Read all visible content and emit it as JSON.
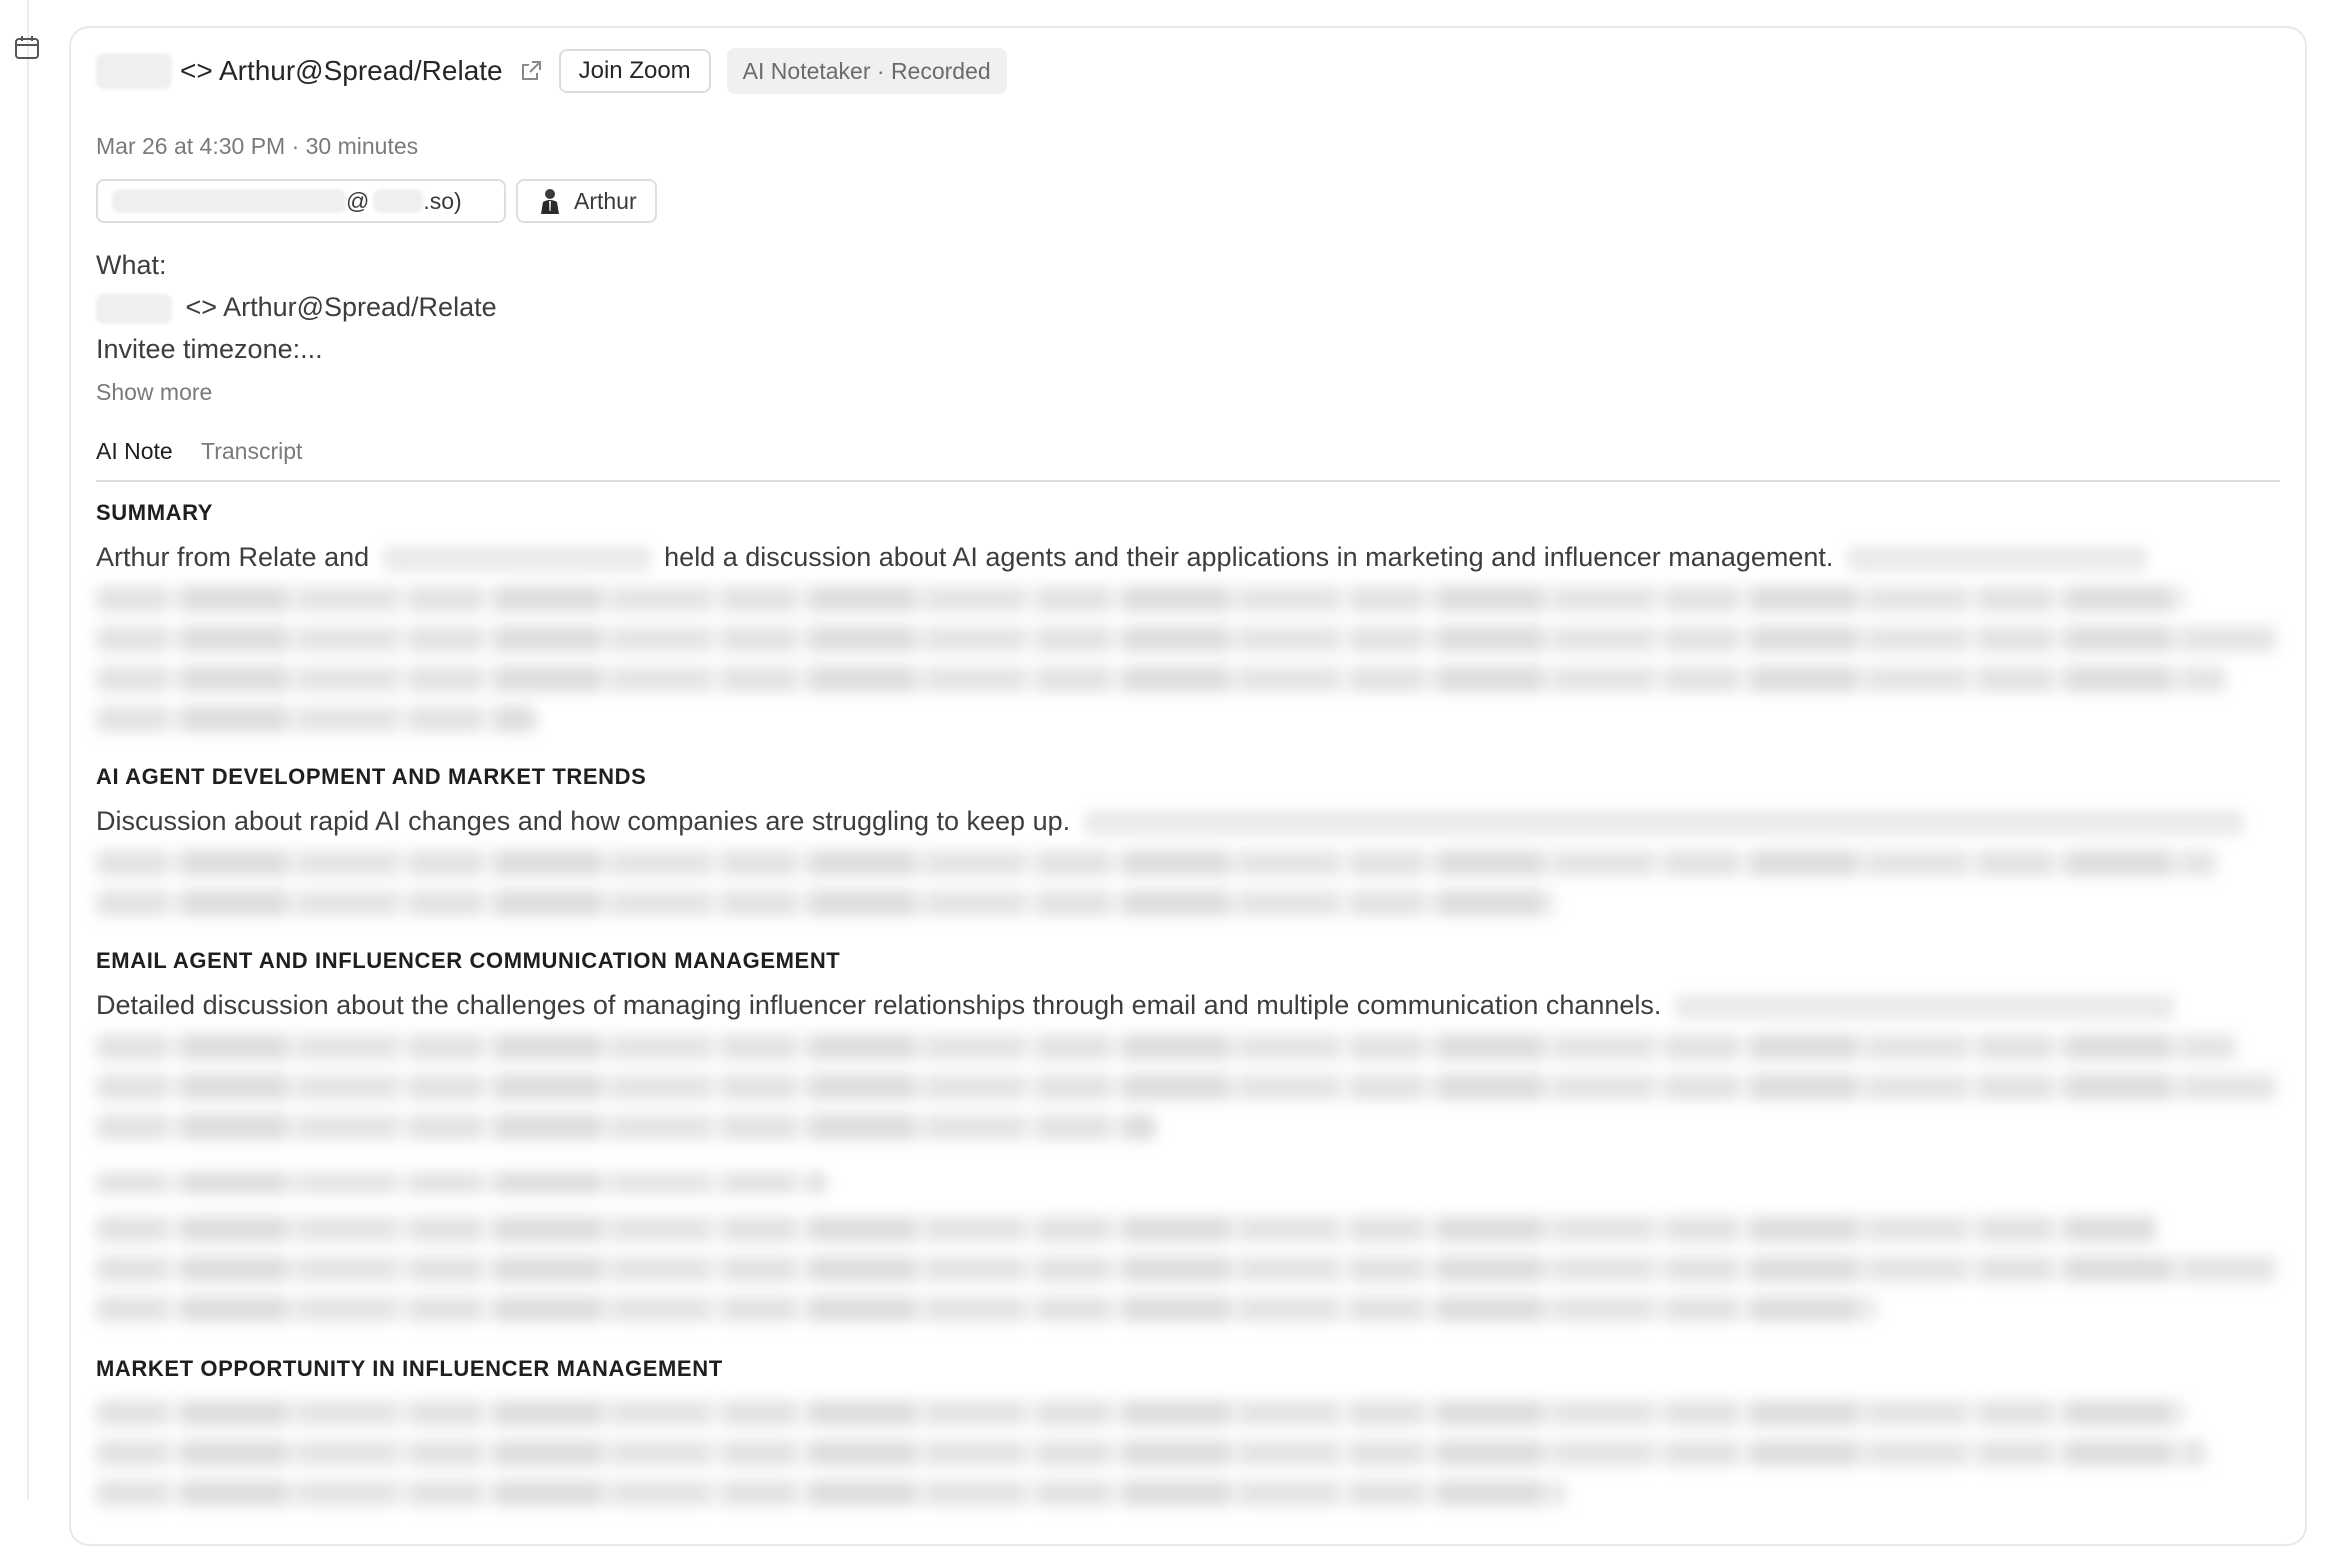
{
  "header": {
    "title_text": "<> Arthur@Spread/Relate",
    "join_button": "Join Zoom",
    "notetaker_badge": "AI Notetaker · Recorded",
    "meta": "Mar 26 at 4:30 PM · 30 minutes"
  },
  "attendees": {
    "email_at": "@",
    "email_suffix": ".so)",
    "arthur": "Arthur"
  },
  "description": {
    "line1": "What:",
    "line2": "<> Arthur@Spread/Relate",
    "line3": "Invitee timezone:...",
    "show_more": "Show more"
  },
  "tabs": {
    "ai_note": "AI Note",
    "transcript": "Transcript"
  },
  "sections": {
    "summary": {
      "title": "SUMMARY",
      "text_start": "Arthur from Relate and",
      "text_end": "held a discussion about AI agents and their applications in marketing and influencer management."
    },
    "ai_agent": {
      "title": "AI AGENT DEVELOPMENT AND MARKET TRENDS",
      "text": "Discussion about rapid AI changes and how companies are struggling to keep up."
    },
    "email_agent": {
      "title": "EMAIL AGENT AND INFLUENCER COMMUNICATION MANAGEMENT",
      "text": "Detailed discussion about the challenges of managing influencer relationships through email and multiple communication channels."
    },
    "market": {
      "title": "MARKET OPPORTUNITY IN INFLUENCER MANAGEMENT"
    }
  }
}
